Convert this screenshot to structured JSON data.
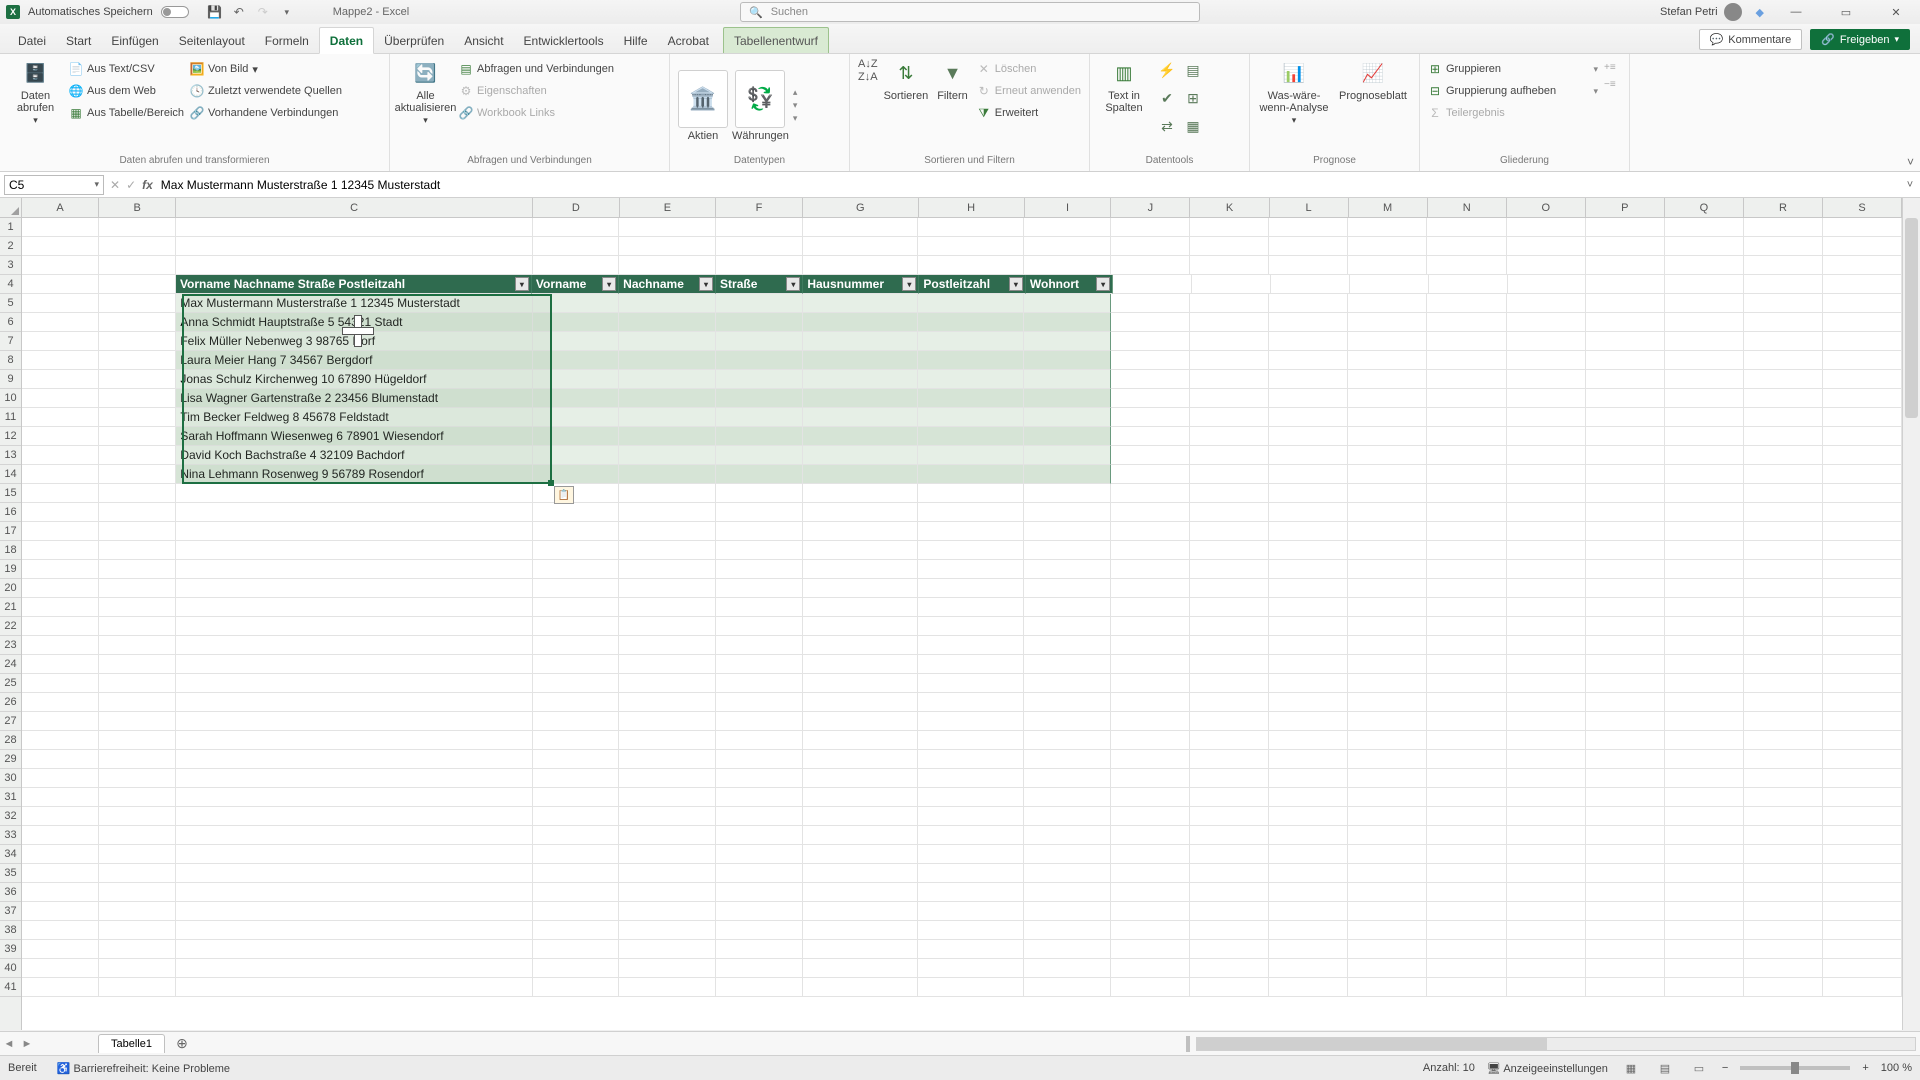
{
  "titlebar": {
    "autosave_label": "Automatisches Speichern",
    "doc_title": "Mappe2 - Excel",
    "search_placeholder": "Suchen",
    "user_name": "Stefan Petri"
  },
  "tabs": {
    "file": "Datei",
    "home": "Start",
    "insert": "Einfügen",
    "pagelayout": "Seitenlayout",
    "formulas": "Formeln",
    "data": "Daten",
    "review": "Überprüfen",
    "view": "Ansicht",
    "developer": "Entwicklertools",
    "help": "Hilfe",
    "acrobat": "Acrobat",
    "tabledesign": "Tabellenentwurf",
    "comments": "Kommentare",
    "share": "Freigeben"
  },
  "ribbon": {
    "get_data": "Daten abrufen",
    "from_textcsv": "Aus Text/CSV",
    "from_web": "Aus dem Web",
    "from_table": "Aus Tabelle/Bereich",
    "from_picture": "Von Bild",
    "recent": "Zuletzt verwendete Quellen",
    "existing": "Vorhandene Verbindungen",
    "group1": "Daten abrufen und transformieren",
    "refresh_all": "Alle aktualisieren",
    "queries": "Abfragen und Verbindungen",
    "properties": "Eigenschaften",
    "workbook_links": "Workbook Links",
    "group2": "Abfragen und Verbindungen",
    "stocks": "Aktien",
    "currencies": "Währungen",
    "group3": "Datentypen",
    "sort": "Sortieren",
    "filter": "Filtern",
    "clear": "Löschen",
    "reapply": "Erneut anwenden",
    "advanced": "Erweitert",
    "group4": "Sortieren und Filtern",
    "text_to_cols": "Text in Spalten",
    "group5": "Datentools",
    "whatif": "Was-wäre-wenn-Analyse",
    "forecast": "Prognoseblatt",
    "group6": "Prognose",
    "groupbtn": "Gruppieren",
    "ungroup": "Gruppierung aufheben",
    "subtotal": "Teilergebnis",
    "group7": "Gliederung"
  },
  "namebox": "C5",
  "formula": "Max Mustermann Musterstraße 1 12345 Musterstadt",
  "columns": [
    "A",
    "B",
    "C",
    "D",
    "E",
    "F",
    "G",
    "H",
    "I",
    "J",
    "K",
    "L",
    "M",
    "N",
    "O",
    "P",
    "Q",
    "R",
    "S"
  ],
  "table": {
    "header_combined": "Vorname Nachname Straße Postleitzahl",
    "headers": [
      "Vorname",
      "Nachname",
      "Straße",
      "Hausnummer",
      "Postleitzahl",
      "Wohnort"
    ],
    "rows": [
      "Max Mustermann Musterstraße 1 12345 Musterstadt",
      "Anna Schmidt Hauptstraße 5 54321 Stadt",
      "Felix Müller Nebenweg 3 98765 Dorf",
      "Laura Meier Hang 7 34567 Bergdorf",
      "Jonas Schulz Kirchenweg 10 67890 Hügeldorf",
      "Lisa Wagner Gartenstraße 2 23456 Blumenstadt",
      "Tim Becker Feldweg 8 45678 Feldstadt",
      "Sarah Hoffmann Wiesenweg 6 78901 Wiesendorf",
      "David Koch Bachstraße 4 32109 Bachdorf",
      "Nina Lehmann Rosenweg 9 56789 Rosendorf"
    ]
  },
  "sheettab": "Tabelle1",
  "status": {
    "ready": "Bereit",
    "accessibility": "Barrierefreiheit: Keine Probleme",
    "count": "Anzahl: 10",
    "display": "Anzeigeeinstellungen",
    "zoom": "100 %"
  }
}
